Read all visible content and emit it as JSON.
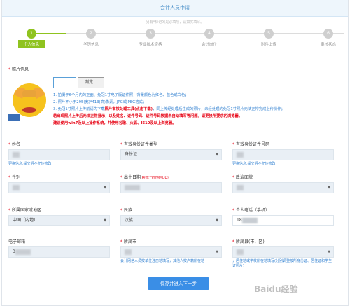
{
  "header": {
    "title": "会计人员申请"
  },
  "subnote": "另有*标记的是必填项，请如实填写。",
  "steps": [
    {
      "num": "1",
      "label": "个人信息"
    },
    {
      "num": "2",
      "label": "学历信息"
    },
    {
      "num": "3",
      "label": "专业技术资格"
    },
    {
      "num": "4",
      "label": "会计岗位"
    },
    {
      "num": "5",
      "label": "附件上传"
    },
    {
      "num": "6",
      "label": "审核状态"
    }
  ],
  "photo": {
    "title": "照片信息",
    "browse_label": "浏览...",
    "note1": "1. 拍摄于6个月内的正面、免冠1寸电子版证件照，背景颜色为红色、蓝色或白色；",
    "note2": "2. 照片不小于295(宽)*413(高)像素，JPG或JPEG格式；",
    "note3a": "3. 免冠1寸照片上传前请先下载",
    "note3link": "照片审核处理工具(点击下载)",
    "note3b": "，同上传经处理后生成的照片，未经处理的免冠1寸照片无法正常完成上传操作；",
    "note4": "若出现照片上传后无法正常显示，以及姓名、证件号码、证件号码数据未自动填写等问题，请更换所要求的浏览器。",
    "note5": "建议使用win7及以上操作系统，并使用谷歌、火狐、IE10及以上浏览器。"
  },
  "fields": {
    "name": {
      "label": "姓名",
      "hint": "更换信息,提交后不允许修改"
    },
    "id_type": {
      "label": "有效身份证件类型",
      "value": "身份证"
    },
    "id_number": {
      "label": "有效身份证件号码",
      "hint": "更换信息,提交后不允许修改"
    },
    "gender": {
      "label": "性别"
    },
    "birth": {
      "label": "出生日期",
      "format": "(格式:YYYYMMDD)"
    },
    "politics": {
      "label": "政治面貌"
    },
    "country": {
      "label": "所属国家或地区",
      "value": "中国（内地）"
    },
    "nation": {
      "label": "民族",
      "value": "汉族"
    },
    "phone": {
      "label": "个人电话（手机）",
      "value": "18"
    },
    "email": {
      "label": "电子邮箱",
      "value": "3"
    },
    "city": {
      "label": "所属市",
      "hint": "会计网信人员按单位注册地填写，其他人按户籍所在地"
    },
    "county": {
      "label": "所属县(市、区)",
      "hint": "，居住地或学校所在地填写(分别调整按所身份证、居住证和学生证照片)"
    }
  },
  "submit_label": "保存并进入下一步",
  "watermark": "Baidu经验"
}
